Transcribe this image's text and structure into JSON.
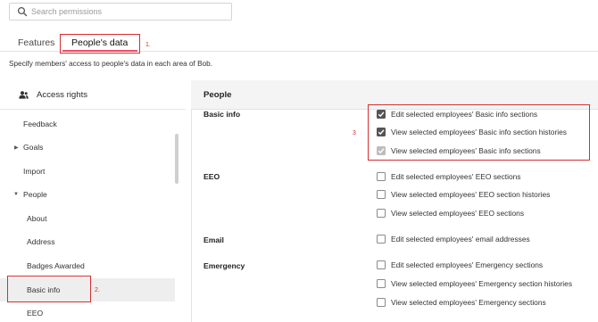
{
  "search": {
    "placeholder": "Search permissions"
  },
  "tabs": [
    {
      "label": "Features",
      "active": false
    },
    {
      "label": "People's data",
      "active": true
    }
  ],
  "annotations": {
    "one": "1.",
    "two": "2.",
    "three": "3",
    "color": "#d32f2f"
  },
  "description": "Specify members' access to people's data in each area of Bob.",
  "access_rights": {
    "title": "Access rights",
    "items": [
      {
        "label": "Feedback"
      },
      {
        "label": "Goals",
        "caret": "right"
      },
      {
        "label": "Import"
      },
      {
        "label": "People",
        "caret": "down"
      },
      {
        "label": "About"
      },
      {
        "label": "Address"
      },
      {
        "label": "Badges Awarded"
      },
      {
        "label": "Basic info",
        "active": true
      },
      {
        "label": "EEO"
      }
    ]
  },
  "panel": {
    "title": "People",
    "sections": [
      {
        "label": "Basic info",
        "permissions": [
          {
            "label": "Edit selected employees' Basic info sections",
            "state": "checked"
          },
          {
            "label": "View selected employees' Basic info section histories",
            "state": "checked"
          },
          {
            "label": "View selected employees' Basic info sections",
            "state": "checked-disabled"
          }
        ]
      },
      {
        "label": "EEO",
        "permissions": [
          {
            "label": "Edit selected employees' EEO sections",
            "state": "unchecked"
          },
          {
            "label": "View selected employees' EEO section histories",
            "state": "unchecked"
          },
          {
            "label": "View selected employees' EEO sections",
            "state": "unchecked"
          }
        ]
      },
      {
        "label": "Email",
        "permissions": [
          {
            "label": "Edit selected employees' email addresses",
            "state": "unchecked"
          }
        ]
      },
      {
        "label": "Emergency",
        "permissions": [
          {
            "label": "Edit selected employees' Emergency sections",
            "state": "unchecked"
          },
          {
            "label": "View selected employees' Emergency section histories",
            "state": "unchecked"
          },
          {
            "label": "View selected employees' Emergency sections",
            "state": "unchecked"
          }
        ]
      }
    ]
  },
  "colors": {
    "tab_underline": "#e84d6e",
    "checkbox_checked": "#555555",
    "checkbox_disabled": "#bdbdbd"
  }
}
